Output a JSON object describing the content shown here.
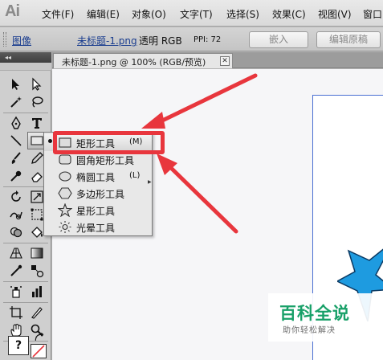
{
  "app": {
    "logo": "Ai"
  },
  "menubar": {
    "items": [
      "文件(F)",
      "编辑(E)",
      "对象(O)",
      "文字(T)",
      "选择(S)",
      "效果(C)",
      "视图(V)",
      "窗口"
    ]
  },
  "controlbar": {
    "image_label": "图像",
    "file_name": "未标题-1.png",
    "mode": "透明 RGB",
    "ppi": "PPI: 72",
    "embed_button": "嵌入",
    "edit_original_button": "编辑原稿"
  },
  "toolpanel": {
    "collapse_glyph": "◂◂"
  },
  "document": {
    "tab_title": "未标题-1.png @ 100% (RGB/预览)",
    "close_glyph": "✕"
  },
  "flyout": {
    "items": [
      {
        "label": "矩形工具",
        "shortcut": "(M)",
        "icon": "rectangle-icon",
        "selected": true
      },
      {
        "label": "圆角矩形工具",
        "shortcut": "",
        "icon": "rounded-rectangle-icon",
        "selected": false
      },
      {
        "label": "椭圆工具",
        "shortcut": "(L)",
        "icon": "ellipse-icon",
        "selected": false
      },
      {
        "label": "多边形工具",
        "shortcut": "",
        "icon": "polygon-icon",
        "selected": false
      },
      {
        "label": "星形工具",
        "shortcut": "",
        "icon": "star-icon",
        "selected": false
      },
      {
        "label": "光晕工具",
        "shortcut": "",
        "icon": "flare-icon",
        "selected": false
      }
    ],
    "submenu_arrow": "▶"
  },
  "colors": {
    "highlight": "#e8363d",
    "arrow": "#e8363d",
    "star_fill": "#1e9be0",
    "artboard_edge": "#4a6fd2",
    "watermark_green": "#18a068"
  },
  "watermark": {
    "main": "百科全说",
    "sub": "助你轻松解决"
  },
  "help_glyph": "?"
}
